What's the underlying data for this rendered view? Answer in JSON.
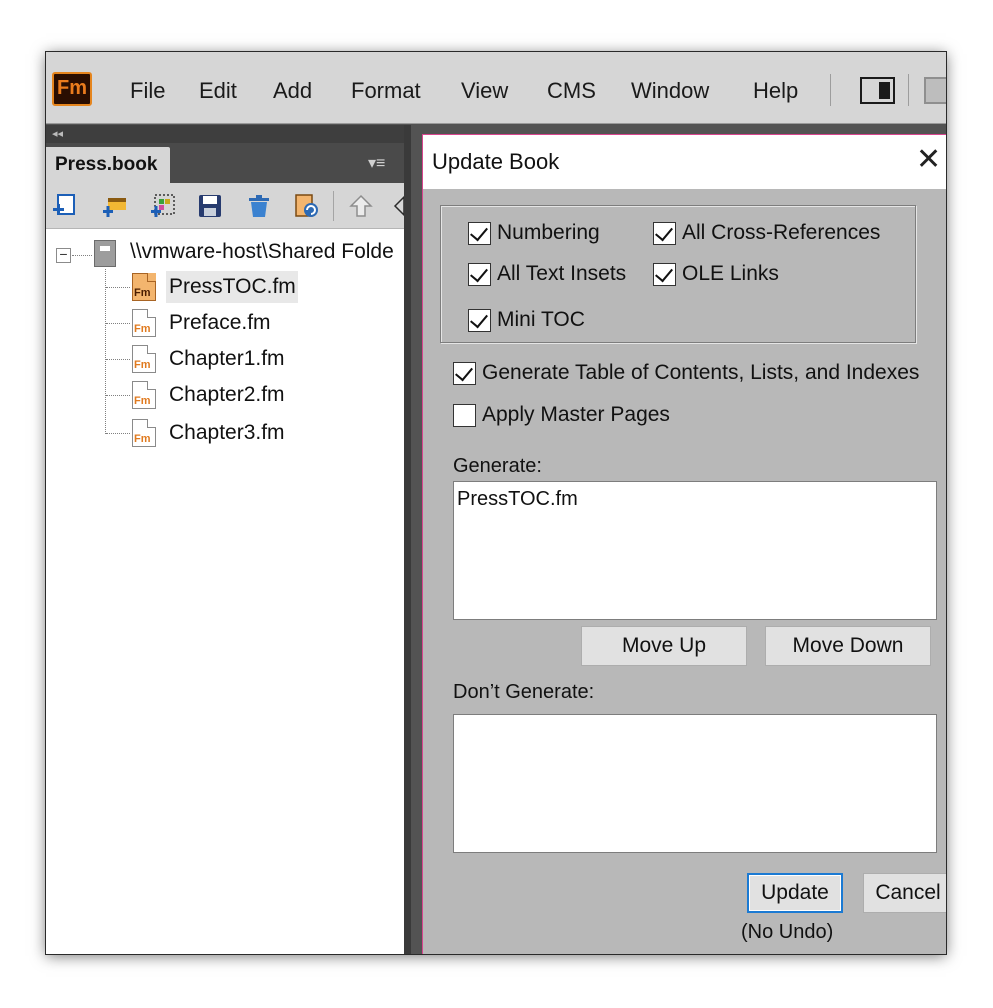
{
  "app": {
    "logo_text": "Fm",
    "menu": [
      "File",
      "Edit",
      "Add",
      "Format",
      "View",
      "CMS",
      "Window",
      "Help"
    ]
  },
  "panel": {
    "collapse_glyph": "◂◂",
    "tab_label": "Press.book",
    "menu_glyph": "▾≡",
    "toolbar_icons": [
      "add-file-icon",
      "add-folder-icon",
      "add-group-icon",
      "save-icon",
      "delete-icon",
      "update-book-icon",
      "move-up-icon",
      "move-down-icon"
    ],
    "tree": {
      "root_label": "\\\\vmware-host\\Shared Folde",
      "expander": "−",
      "files": [
        "PressTOC.fm",
        "Preface.fm",
        "Chapter1.fm",
        "Chapter2.fm",
        "Chapter3.fm"
      ],
      "file_icon_text": "Fm",
      "selected_index": 0
    }
  },
  "dialog": {
    "title": "Update Book",
    "close_glyph": "✕",
    "options": {
      "numbering": "Numbering",
      "cross_refs": "All Cross-References",
      "text_insets": "All Text Insets",
      "ole_links": "OLE Links",
      "mini_toc": "Mini TOC"
    },
    "generate_toc": "Generate Table of Contents, Lists, and Indexes",
    "apply_master": "Apply Master Pages",
    "generate_label": "Generate:",
    "generate_items": [
      "PressTOC.fm"
    ],
    "move_up": "Move Up",
    "move_down": "Move Down",
    "dont_generate_label": "Don’t Generate:",
    "update_button": "Update",
    "cancel_button": "Cancel",
    "no_undo": "(No Undo)"
  },
  "colors": {
    "dialog_border": "#d8458e",
    "default_button_border": "#1b7ad3",
    "app_logo": "#e5851e"
  }
}
